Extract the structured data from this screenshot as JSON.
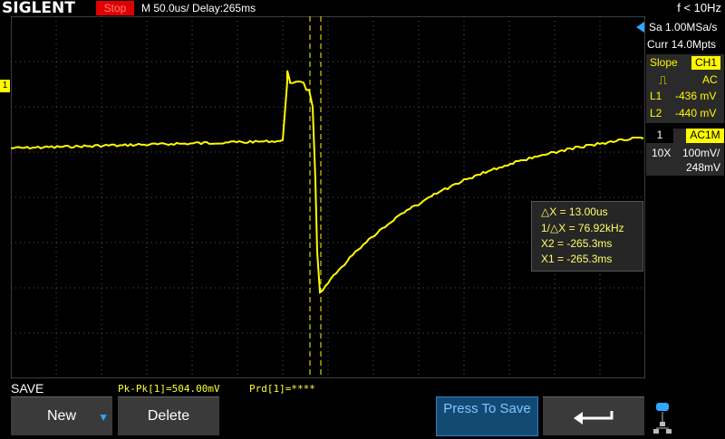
{
  "top": {
    "brand": "SIGLENT",
    "run_state": "Stop",
    "timebase": "M 50.0us/",
    "delay": "Delay:265ms",
    "trigger_freq": "f < 10Hz"
  },
  "acquisition": {
    "sample_rate": "Sa 1.00MSa/s",
    "memory": "Curr 14.0Mpts"
  },
  "trigger": {
    "slope_label": "Slope",
    "source": "CH1",
    "coupling": "AC",
    "l1_label": "L1",
    "l1_value": "-436 mV",
    "l2_label": "L2",
    "l2_value": "-440 mV"
  },
  "channel": {
    "number": "1",
    "coupling": "AC1M",
    "probe": "10X",
    "scale": "100mV/",
    "offset": "248mV"
  },
  "cursors": {
    "delta_x": "△X = 13.00us",
    "inv_delta_x": "1/△X = 76.92kHz",
    "x2": "X2 = -265.3ms",
    "x1": "X1 = -265.3ms"
  },
  "measurements": {
    "pkpk": "Pk-Pk[1]=504.00mV",
    "prd": "Prd[1]=****"
  },
  "menu": {
    "title": "SAVE",
    "new_label": "New",
    "delete_label": "Delete",
    "press_to_save": "Press To Save"
  },
  "colors": {
    "trace": "#fffb00",
    "stop": "#e00000",
    "accent": "#134a74"
  },
  "trace_shape": {
    "x_unit": "us after trigger",
    "pre_level_div": 0.35,
    "dip_level_div": -1.55,
    "dip_time_us": 10,
    "recovery_level_div": 0.45
  }
}
